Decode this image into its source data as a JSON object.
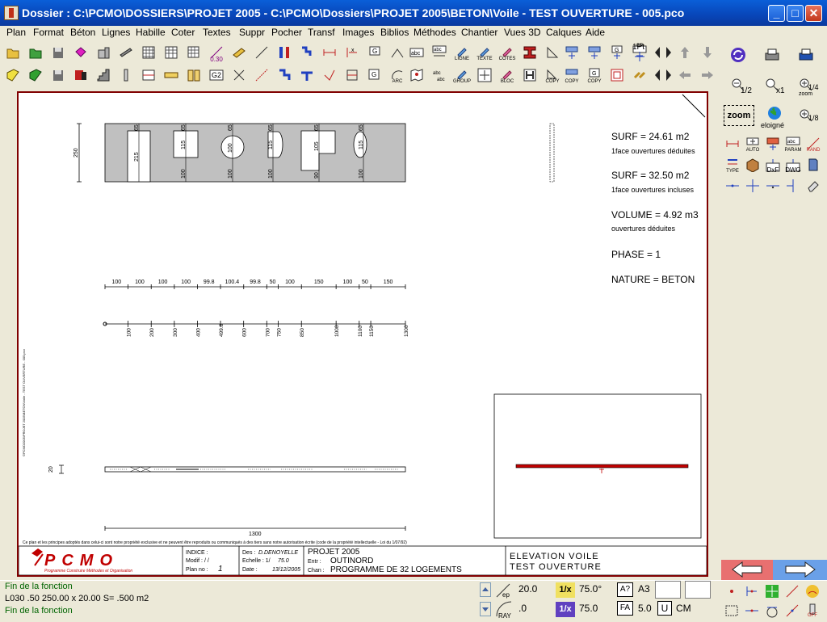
{
  "window": {
    "title": "Dossier : C:\\PCMO\\DOSSIERS\\PROJET 2005 - C:\\PCMO\\Dossiers\\PROJET 2005\\BETON\\Voile - TEST OUVERTURE - 005.pco",
    "controls": [
      "_",
      "□",
      "✕"
    ]
  },
  "menu": [
    "Plan",
    "Format",
    "Béton",
    "Lignes",
    "Habille",
    "Coter",
    "Textes",
    "Suppr",
    "Pocher",
    "Transf",
    "Images",
    "Biblios",
    "Méthodes",
    "Chantier",
    "Vues 3D",
    "Calques",
    "Aide"
  ],
  "toolbar": {
    "row1_labels": {
      "0.30": "0.30",
      "ligne": "LIGNE",
      "texte": "TEXTE",
      "cotes": "COTES",
      "gp": "GP",
      "pt": "1Pt"
    },
    "row2_labels": {
      "g2": "G2",
      "arc": "ARC",
      "group": "GROUP",
      "bloc": "BLOC",
      "copy1": "COPY",
      "copy2": "COPY",
      "copy3": "COPY"
    }
  },
  "drawing": {
    "props": {
      "surf1": "SURF =  24.61 m2",
      "surf1_note": "1face ouvertures déduites",
      "surf2": "SURF =  32.50 m2",
      "surf2_note": "1face ouvertures incluses",
      "volume": "VOLUME =   4.92 m3",
      "volume_note": "ouvertures déduites",
      "phase": "PHASE  = 1",
      "nature": "NATURE = BETON"
    },
    "elevation": {
      "height_dim": "250",
      "openings": [
        "215",
        "115",
        "100",
        "115",
        "105",
        "115"
      ],
      "top_dims": [
        "65",
        "65",
        "65",
        "65",
        "65",
        "65"
      ],
      "bottom_dims": [
        "100",
        "100",
        "100",
        "100",
        "90",
        "100"
      ]
    },
    "dimline1": [
      "100",
      "100",
      "100",
      "100",
      "99.8",
      "100.4",
      "99.8",
      "50",
      "100",
      "150",
      "100",
      "50",
      "150"
    ],
    "dimline2": [
      "100",
      "200",
      "300",
      "400",
      "499.8",
      "600",
      "700",
      "750",
      "850",
      "1000",
      "1100",
      "1150",
      "1300"
    ],
    "plan_thickness": "20",
    "total_length": "1300",
    "side_text": "©PCMO2005\\PROJET 2005\\BETON\\Voile - TEST OUVERTURE - 005.pco",
    "copyright": "Ce plan et les principes adoptés dans celui-ci sont notre propriété exclusive et ne peuvent être reproduits ou communiqués à des tiers sans notre autorisation écrite (code de la propriété intellectuelle - Loi du 1/07/92)"
  },
  "cartouche": {
    "logo_text": "PCMO",
    "logo_sub": "Programme Construire Méthodes et Organisation",
    "indice": "INDICE :",
    "modif": "Modif :  / /",
    "plan_no_label": "Plan no :",
    "plan_no": "1",
    "des_label": "Des :",
    "des": "D.DENOYELLE",
    "echelle_label": "Echelle : 1/",
    "echelle": "75.0",
    "date_label": "Date :",
    "date": "13/12/2005",
    "project": "PROJET 2005",
    "entr_label": "Entr :",
    "entr": "OUTINORD",
    "chan_label": "Chan :",
    "chan": "PROGRAMME DE 32 LOGEMENTS",
    "title1": "ELEVATION VOILE",
    "title2": "TEST OUVERTURE"
  },
  "right_panel": {
    "half": "1/2",
    "x1": "x1",
    "quarter": "1/4",
    "zoom_small": "zoom",
    "zoom_btn": "zoom",
    "eloigne": "eloigné",
    "eighth": "1/8",
    "auto": "AUTO",
    "param": "PARAM",
    "rand": "RAND",
    "type": "TYPE",
    "dxf": "DxF",
    "dwg": "DWG"
  },
  "status": {
    "line1": "Fin de la fonction",
    "line2": "L030  .50       250.00 x   20.00 S=        .500 m2",
    "line3": "Fin de la fonction",
    "ep_label": "ep",
    "ep_value": "20.0",
    "ray_label": "RAY",
    "ray_value": ".0",
    "ratio_btn": "1/x",
    "angle_value": "75.0°",
    "ratio_btn2": "1/x",
    "scale_value": "75.0",
    "query_btn": "A?",
    "format": "A3",
    "fa_btn": "FA",
    "fa_value": "5.0",
    "u_btn": "U",
    "unit": "CM",
    "off": "OFF"
  },
  "colors": {
    "titlebar": "#0a5fd8",
    "frame": "#800000",
    "wall": "#c0c0c0",
    "section": "#c00000",
    "status_text": "#006400",
    "arrow_bg": "#e87070",
    "arrow_bg2": "#6aa0e8"
  }
}
